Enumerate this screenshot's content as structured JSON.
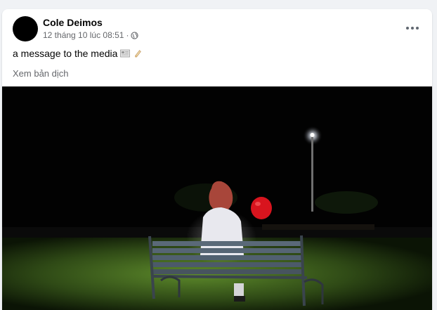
{
  "post": {
    "author": "Cole Deimos",
    "timestamp": "12 tháng 10 lúc 08:51",
    "separator": "·",
    "privacy_icon": "globe-icon",
    "text": "a message to the media",
    "emojis": [
      "newspaper-icon",
      "scroll-icon"
    ],
    "translate_label": "Xem bản dịch",
    "more_icon": "more-options-icon"
  },
  "colors": {
    "page_bg": "#f0f2f5",
    "card_bg": "#ffffff",
    "primary_text": "#050505",
    "secondary_text": "#65676b",
    "balloon": "#d8141e"
  }
}
